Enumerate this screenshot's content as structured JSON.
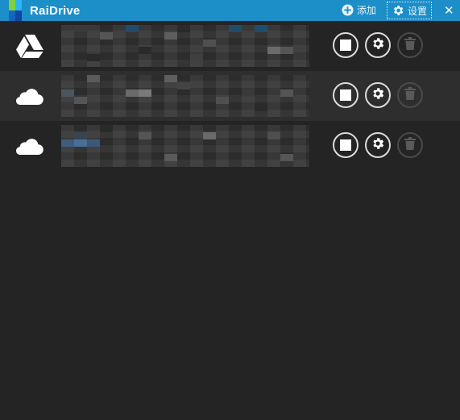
{
  "app": {
    "title": "RaiDrive"
  },
  "toolbar": {
    "add_label": "添加",
    "settings_label": "设置",
    "close_glyph": "✕"
  },
  "drives": [
    {
      "service": "google-drive",
      "icon": "google-drive-icon",
      "name": "",
      "path": "",
      "selected": false
    },
    {
      "service": "onedrive",
      "icon": "cloud-icon",
      "name": "",
      "path": "",
      "selected": true
    },
    {
      "service": "onedrive",
      "icon": "cloud-icon",
      "name": "",
      "path": "",
      "selected": false
    }
  ],
  "colors": {
    "titlebar": "#1c8ec8",
    "background": "#242424",
    "selected_row": "#2e2e2e"
  }
}
